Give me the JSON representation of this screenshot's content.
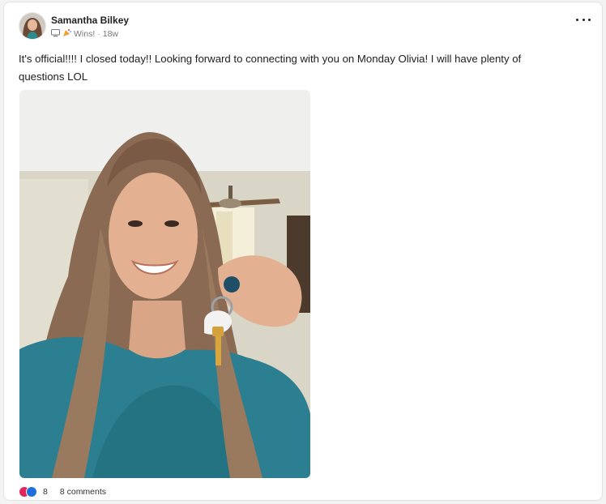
{
  "post": {
    "author": "Samantha Bilkey",
    "category": "Wins!",
    "time": "18w",
    "text": "It's official!!!! I closed today!! Looking forward to connecting with you on Monday Olivia! I will have plenty of questions LOL",
    "reactions_count": "8",
    "comments_label": "8 comments"
  },
  "icons": {
    "menu": "more-horizontal-icon",
    "device": "monitor-icon",
    "category": "party-icon",
    "reaction_1": "heart-icon",
    "reaction_2": "clap-icon"
  },
  "colors": {
    "reaction_heart": "#e0245e",
    "reaction_clap": "#1d6fdc"
  }
}
